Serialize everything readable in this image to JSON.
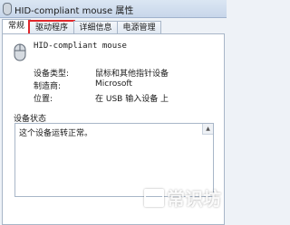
{
  "window": {
    "title": "HID-compliant mouse 属性"
  },
  "tabs": [
    {
      "label": "常规"
    },
    {
      "label": "驱动程序"
    },
    {
      "label": "详细信息"
    },
    {
      "label": "电源管理"
    }
  ],
  "device": {
    "name": "HID-compliant mouse",
    "icon": "mouse-icon"
  },
  "properties": [
    {
      "label": "设备类型:",
      "value": "鼠标和其他指针设备"
    },
    {
      "label": "制造商:",
      "value": "Microsoft"
    },
    {
      "label": "位置:",
      "value": "在 USB 输入设备 上"
    }
  ],
  "status": {
    "group_label": "设备状态",
    "text": "这个设备运转正常。"
  },
  "watermark": {
    "text": "常识坊"
  }
}
